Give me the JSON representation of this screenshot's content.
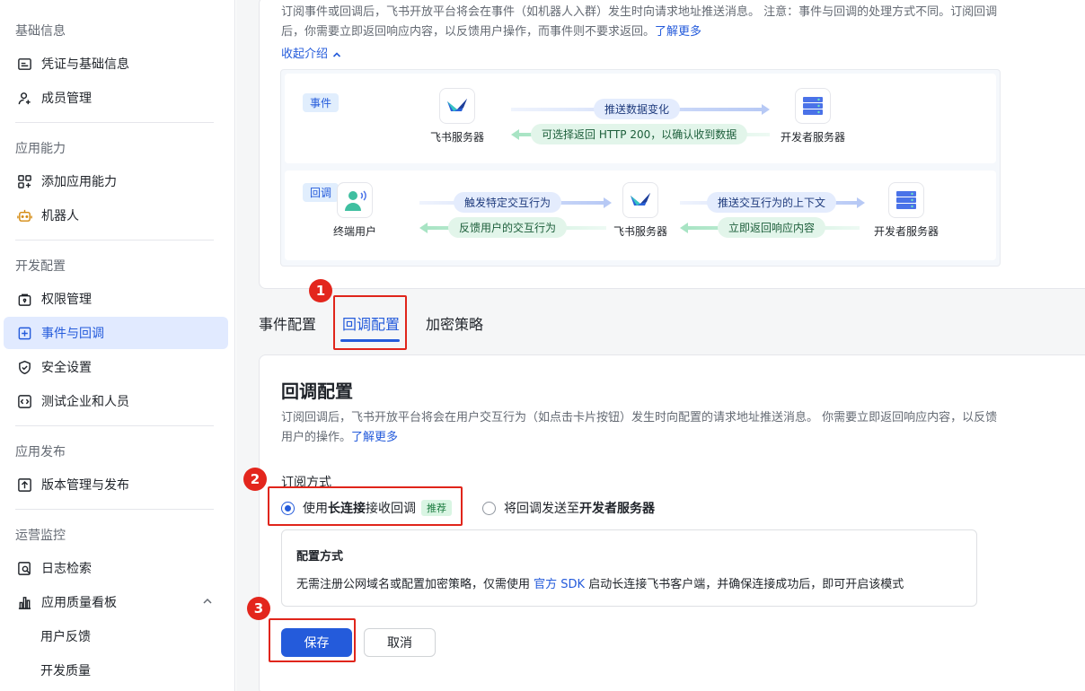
{
  "sidebar": {
    "sections": [
      {
        "title": "基础信息",
        "items": [
          {
            "label": "凭证与基础信息",
            "icon": "credential-icon"
          },
          {
            "label": "成员管理",
            "icon": "member-add-icon"
          }
        ]
      },
      {
        "title": "应用能力",
        "items": [
          {
            "label": "添加应用能力",
            "icon": "grid-add-icon"
          },
          {
            "label": "机器人",
            "icon": "robot-icon"
          }
        ]
      },
      {
        "title": "开发配置",
        "items": [
          {
            "label": "权限管理",
            "icon": "lock-box-icon"
          },
          {
            "label": "事件与回调",
            "icon": "event-icon",
            "active": true
          },
          {
            "label": "安全设置",
            "icon": "shield-icon"
          },
          {
            "label": "测试企业和人员",
            "icon": "code-icon"
          }
        ]
      },
      {
        "title": "应用发布",
        "items": [
          {
            "label": "版本管理与发布",
            "icon": "upload-icon"
          }
        ]
      },
      {
        "title": "运营监控",
        "items": [
          {
            "label": "日志检索",
            "icon": "log-search-icon"
          },
          {
            "label": "应用质量看板",
            "icon": "chart-icon"
          },
          {
            "label": "用户反馈"
          },
          {
            "label": "开发质量"
          }
        ]
      }
    ]
  },
  "intro": {
    "text": "订阅事件或回调后，飞书开放平台将会在事件（如机器人入群）发生时向请求地址推送消息。 注意：事件与回调的处理方式不同。订阅回调后，你需要立即返回响应内容，以反馈用户操作，而事件则不要求返回。",
    "learn_more": "了解更多",
    "collapse": "收起介绍"
  },
  "diagram": {
    "event": {
      "tag": "事件",
      "left_node": "飞书服务器",
      "right_node": "开发者服务器",
      "push_label": "推送数据变化",
      "return_label": "可选择返回 HTTP 200，以确认收到数据"
    },
    "callback": {
      "tag": "回调",
      "node_user": "终端用户",
      "node_feishu": "飞书服务器",
      "node_dev": "开发者服务器",
      "trigger_label": "触发特定交互行为",
      "feedback_label": "反馈用户的交互行为",
      "push_label": "推送交互行为的上下文",
      "return_label": "立即返回响应内容"
    }
  },
  "tabs": [
    "事件配置",
    "回调配置",
    "加密策略"
  ],
  "active_tab": "回调配置",
  "callback_config": {
    "title": "回调配置",
    "desc": "订阅回调后，飞书开放平台将会在用户交互行为（如点击卡片按钮）发生时向配置的请求地址推送消息。 你需要立即返回响应内容，以反馈用户的操作。",
    "learn_more": "了解更多",
    "subscribe_label": "订阅方式",
    "option1_pre": "使用 ",
    "option1_bold": "长连接",
    "option1_post": " 接收回调",
    "option1_badge": "推荐",
    "option2_pre": "将回调发送至 ",
    "option2_bold": "开发者服务器",
    "info_title": "配置方式",
    "info_pre": "无需注册公网域名或配置加密策略，仅需使用 ",
    "info_link": "官方 SDK",
    "info_post": " 启动长连接飞书客户端，并确保连接成功后，即可开启该模式",
    "save": "保存",
    "cancel": "取消"
  },
  "annotations": [
    "1",
    "2",
    "3"
  ],
  "colors": {
    "accent": "#245bdb",
    "annotation": "#e0251b",
    "active_bg": "#e1eaff"
  }
}
